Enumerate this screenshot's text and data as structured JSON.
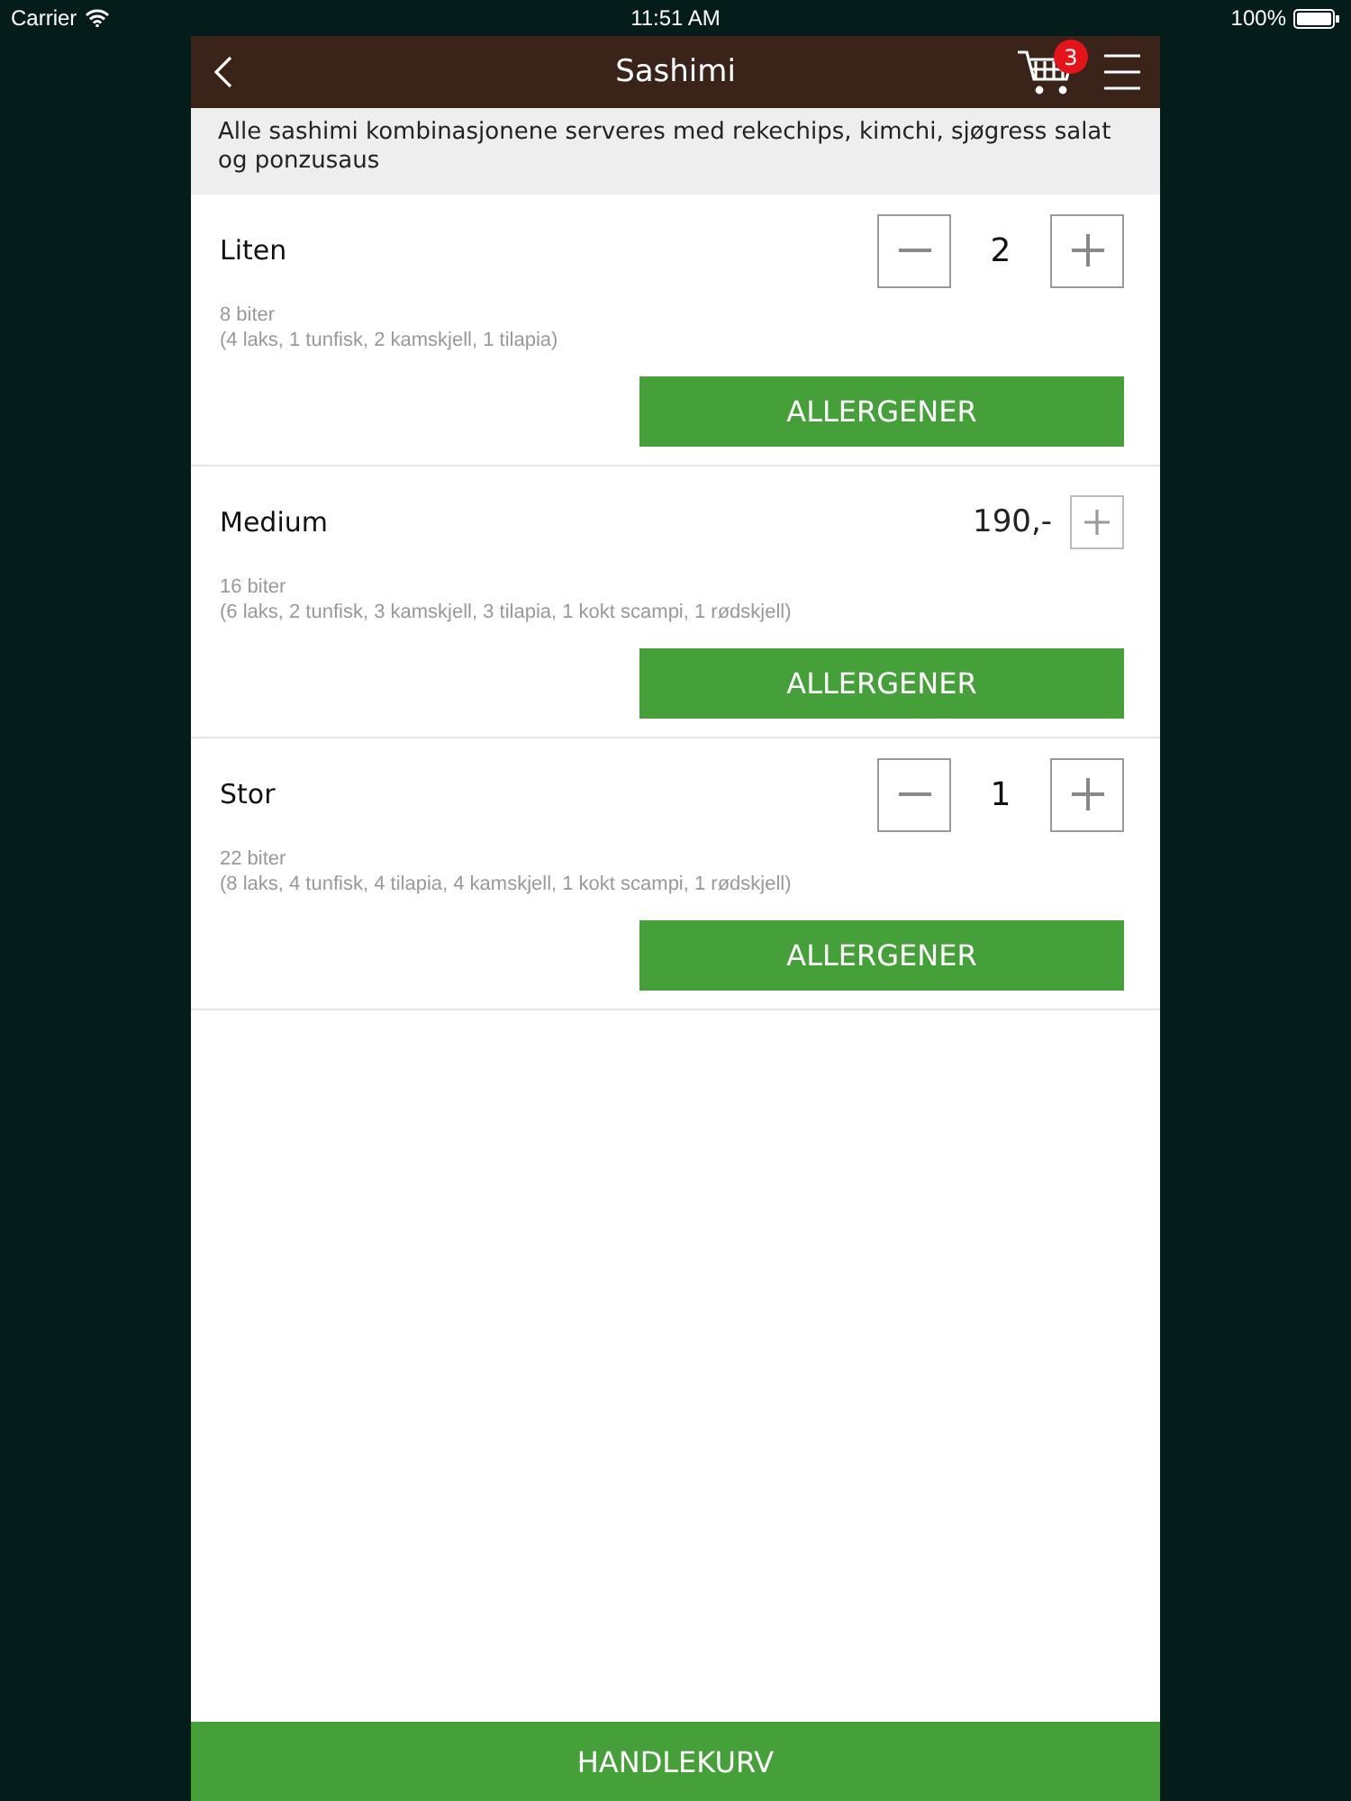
{
  "status_bar": {
    "carrier": "Carrier",
    "time": "11:51 AM",
    "battery": "100%"
  },
  "nav_bar": {
    "title": "Sashimi",
    "cart_count": "3"
  },
  "notice": "Alle sashimi kombinasjonene serveres med rekechips, kimchi, sjøgress salat og ponzusaus",
  "items": [
    {
      "kind": "quantity",
      "name": "Liten",
      "quantity": "2",
      "pieces": "8 biter",
      "contents": "(4 laks, 1 tunfisk, 2 kamskjell, 1 tilapia)",
      "button": "ALLERGENER"
    },
    {
      "kind": "price",
      "name": "Medium",
      "price": "190,-",
      "pieces": "16 biter",
      "contents": "(6 laks, 2 tunfisk, 3 kamskjell, 3 tilapia, 1 kokt scampi, 1 rødskjell)",
      "button": "ALLERGENER"
    },
    {
      "kind": "quantity",
      "name": "Stor",
      "quantity": "1",
      "pieces": "22 biter",
      "contents": "(8 laks, 4 tunfisk, 4 tilapia, 4 kamskjell, 1 kokt scampi, 1 rødskjell)",
      "button": "ALLERGENER"
    }
  ],
  "footer_button": "HANDLEKURV"
}
